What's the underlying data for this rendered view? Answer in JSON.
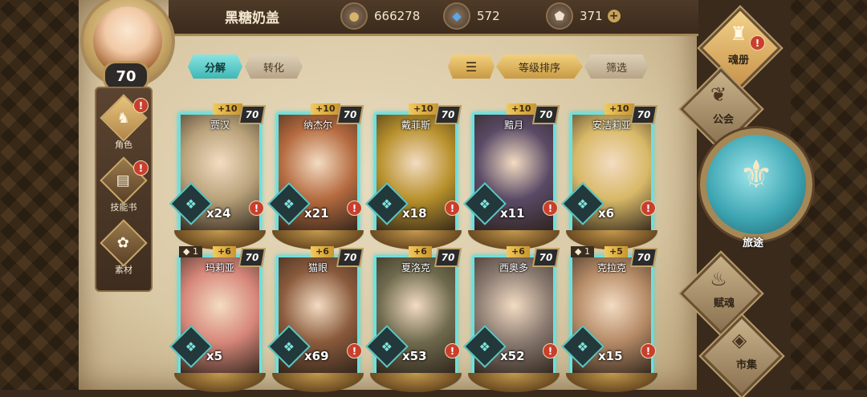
{
  "player": {
    "name": "黑糖奶盖",
    "level": "70"
  },
  "resources": {
    "gold": {
      "icon": "gold-coin-icon",
      "value": "666278"
    },
    "crystal": {
      "icon": "blue-crystal-icon",
      "value": "572"
    },
    "gem": {
      "icon": "gem-icon",
      "value": "371"
    }
  },
  "side_menu": [
    {
      "label": "角色",
      "alert": "!"
    },
    {
      "label": "技能书",
      "alert": "!"
    },
    {
      "label": "素材",
      "alert": ""
    }
  ],
  "tabs": {
    "decompose": "分解",
    "convert": "转化",
    "sort_label": "等级排序",
    "filter": "筛选"
  },
  "cards": [
    {
      "name": "贾汉",
      "level": "70",
      "plus": "+10",
      "star": "",
      "count": "x24",
      "alert": "!",
      "hue": "#b9a27a"
    },
    {
      "name": "纳杰尔",
      "level": "70",
      "plus": "+10",
      "star": "",
      "count": "x21",
      "alert": "!",
      "hue": "#b56a3f"
    },
    {
      "name": "戴菲斯",
      "level": "70",
      "plus": "+10",
      "star": "",
      "count": "x18",
      "alert": "!",
      "hue": "#b8912c"
    },
    {
      "name": "黯月",
      "level": "70",
      "plus": "+10",
      "star": "",
      "count": "x11",
      "alert": "!",
      "hue": "#5a4a66"
    },
    {
      "name": "安洁莉亚",
      "level": "70",
      "plus": "+10",
      "star": "",
      "count": "x6",
      "alert": "!",
      "hue": "#d8b968"
    },
    {
      "name": "玛莉亚",
      "level": "70",
      "plus": "+6",
      "star": "1",
      "count": "x5",
      "alert": "",
      "hue": "#d7877a"
    },
    {
      "name": "猫眼",
      "level": "70",
      "plus": "+6",
      "star": "",
      "count": "x69",
      "alert": "!",
      "hue": "#8a5a3c"
    },
    {
      "name": "夏洛克",
      "level": "70",
      "plus": "+6",
      "star": "",
      "count": "x53",
      "alert": "!",
      "hue": "#6f6a4e"
    },
    {
      "name": "西奥多",
      "level": "70",
      "plus": "+6",
      "star": "",
      "count": "x52",
      "alert": "!",
      "hue": "#8a7a70"
    },
    {
      "name": "克拉克",
      "level": "70",
      "plus": "+5",
      "star": "1",
      "count": "x15",
      "alert": "!",
      "hue": "#b58a66"
    }
  ],
  "right_menu": {
    "soul_book": "魂册",
    "guild": "公会",
    "journey": "旅途",
    "fusing_soul": "赋魂",
    "market": "市集",
    "alert": "!"
  }
}
